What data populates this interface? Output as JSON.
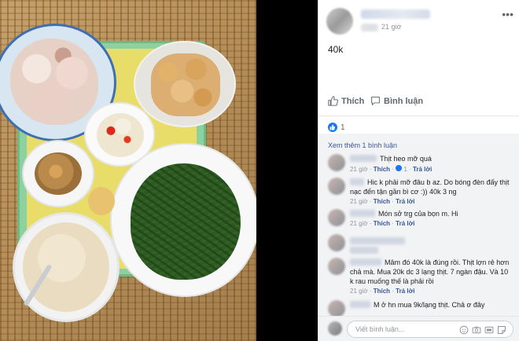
{
  "post": {
    "time": "21 giờ",
    "text": "40k"
  },
  "actions": {
    "like_label": "Thích",
    "comment_label": "Bình luận"
  },
  "reactions": {
    "count": "1"
  },
  "comments": {
    "more_label": "Xem thêm 1 bình luận",
    "items": [
      {
        "text": "Thịt heo mỡ quá",
        "time": "21 giờ",
        "like": "Thích",
        "likes": "1",
        "reply": "Trả lời"
      },
      {
        "text": "Hic k phải mỡ đâu b az. Do bóng đèn đấy thịt nạc đến tận gần bì cơ :)) 40k 3 ng",
        "time": "21 giờ",
        "like": "Thích",
        "reply": "Trả lời"
      },
      {
        "text": "Món sở trg của bọn m. Hi",
        "time": "21 giờ",
        "like": "Thích",
        "reply": "Trả lời"
      },
      {
        "text": "",
        "time": "",
        "like": "",
        "reply": ""
      },
      {
        "text": "Mâm đó 40k là đúng rồi. Thịt lợn rẻ hơn chả mà. Mua 20k dc 3 lạng thịt. 7 ngàn đậu. Và 10 k rau muống thế là phải rồi",
        "time": "21 giờ",
        "like": "Thích",
        "reply": "Trả lời"
      },
      {
        "text": "M ở hn mua 9k/lạng thịt. Chả ơ đây",
        "time": "",
        "like": "",
        "reply": ""
      }
    ]
  },
  "compose": {
    "placeholder": "Viết bình luận..."
  },
  "icons": {
    "like": "thumbs-up-icon",
    "comment": "speech-bubble-icon",
    "menu": "more-dots-icon",
    "emoji": "emoji-icon",
    "camera": "camera-icon",
    "gif": "gif-icon",
    "sticker": "sticker-icon"
  },
  "colors": {
    "link": "#385898",
    "accent": "#1877f2"
  }
}
